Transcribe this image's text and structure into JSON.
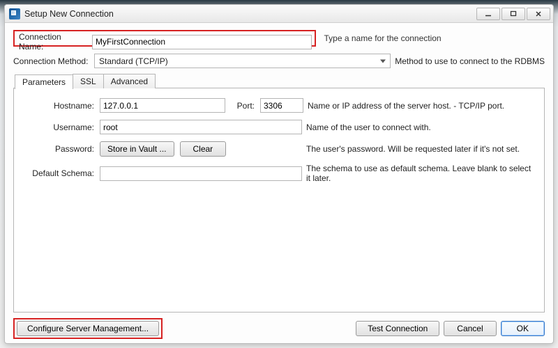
{
  "window": {
    "title": "Setup New Connection"
  },
  "connectionName": {
    "label": "Connection Name:",
    "value": "MyFirstConnection",
    "desc": "Type a name for the connection"
  },
  "connectionMethod": {
    "label": "Connection Method:",
    "value": "Standard (TCP/IP)",
    "desc": "Method to use to connect to the RDBMS"
  },
  "tabs": {
    "parameters": "Parameters",
    "ssl": "SSL",
    "advanced": "Advanced"
  },
  "params": {
    "hostname": {
      "label": "Hostname:",
      "value": "127.0.0.1",
      "help": "Name or IP address of the server host. - TCP/IP port."
    },
    "port": {
      "label": "Port:",
      "value": "3306"
    },
    "username": {
      "label": "Username:",
      "value": "root",
      "help": "Name of the user to connect with."
    },
    "password": {
      "label": "Password:",
      "storeBtn": "Store in Vault ...",
      "clearBtn": "Clear",
      "help": "The user's password. Will be requested later if it's not set."
    },
    "schema": {
      "label": "Default Schema:",
      "value": "",
      "help": "The schema to use as default schema. Leave blank to select it later."
    }
  },
  "footer": {
    "configure": "Configure Server Management...",
    "test": "Test Connection",
    "cancel": "Cancel",
    "ok": "OK"
  }
}
